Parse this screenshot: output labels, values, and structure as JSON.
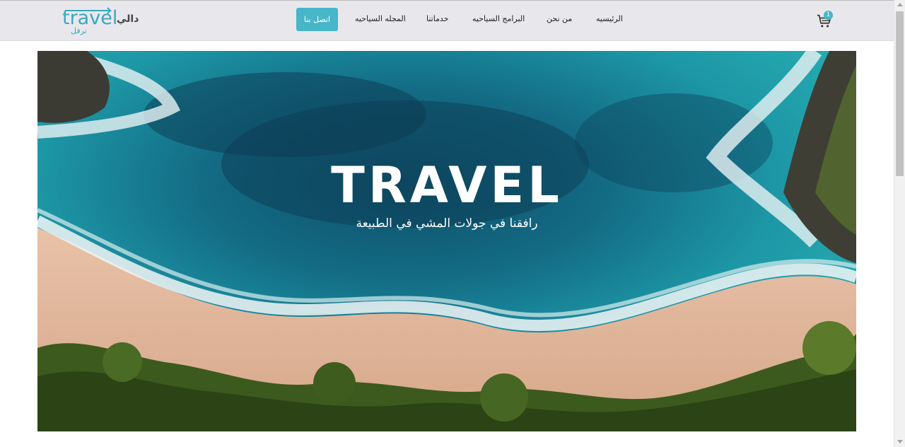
{
  "navbar": {
    "logo_word": "travel",
    "logo_arabic": "دالي",
    "logo_sub": "ترفل",
    "items": [
      {
        "label": "الرئيسيه"
      },
      {
        "label": "من نحن"
      },
      {
        "label": "البرامج السياحيه"
      },
      {
        "label": "خدماتنا"
      },
      {
        "label": "المجله السياحيه"
      }
    ],
    "contact_label": "اتصل بنا",
    "cart_icon": "cart-icon",
    "cart_count": "1"
  },
  "hero": {
    "title": "TRAVEL",
    "subtitle": "رافقنا في جولات المشي في الطبيعة"
  },
  "colors": {
    "accent": "#47b6c9",
    "navbar_bg": "#e8e8ec",
    "logo": "#3aa8bd"
  }
}
